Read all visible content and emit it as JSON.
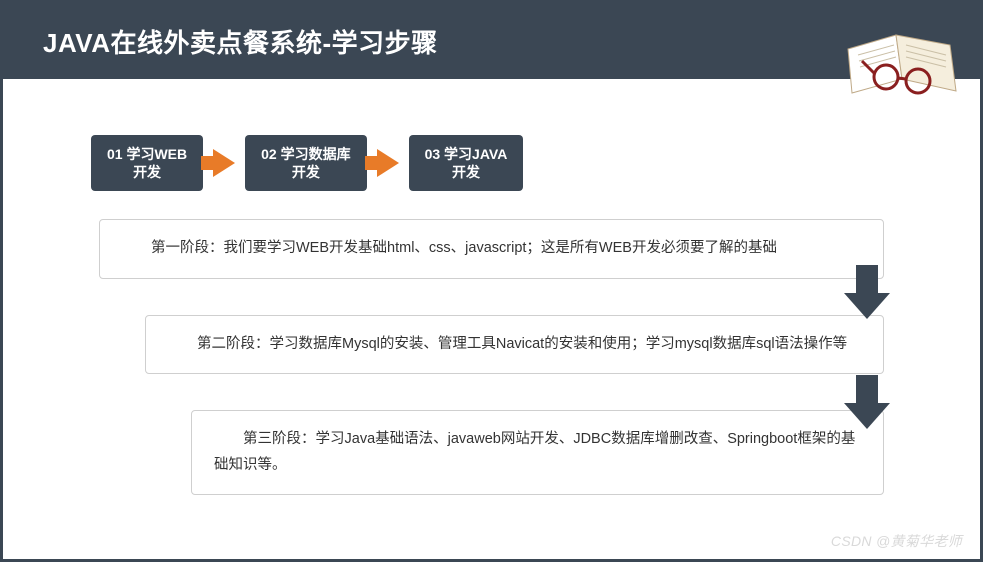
{
  "header": {
    "title": "JAVA在线外卖点餐系统-学习步骤"
  },
  "steps": [
    {
      "label": "01 学习WEB\n开发"
    },
    {
      "label": "02 学习数据库\n开发"
    },
    {
      "label": "03 学习JAVA\n开发"
    }
  ],
  "phases": [
    {
      "text": "第一阶段：我们要学习WEB开发基础html、css、javascript；这是所有WEB开发必须要了解的基础"
    },
    {
      "text": "第二阶段：学习数据库Mysql的安装、管理工具Navicat的安装和使用；学习mysql数据库sql语法操作等"
    },
    {
      "text": "第三阶段：学习Java基础语法、javaweb网站开发、JDBC数据库增删改查、Springboot框架的基础知识等。"
    }
  ],
  "watermark": "CSDN @黄菊华老师"
}
